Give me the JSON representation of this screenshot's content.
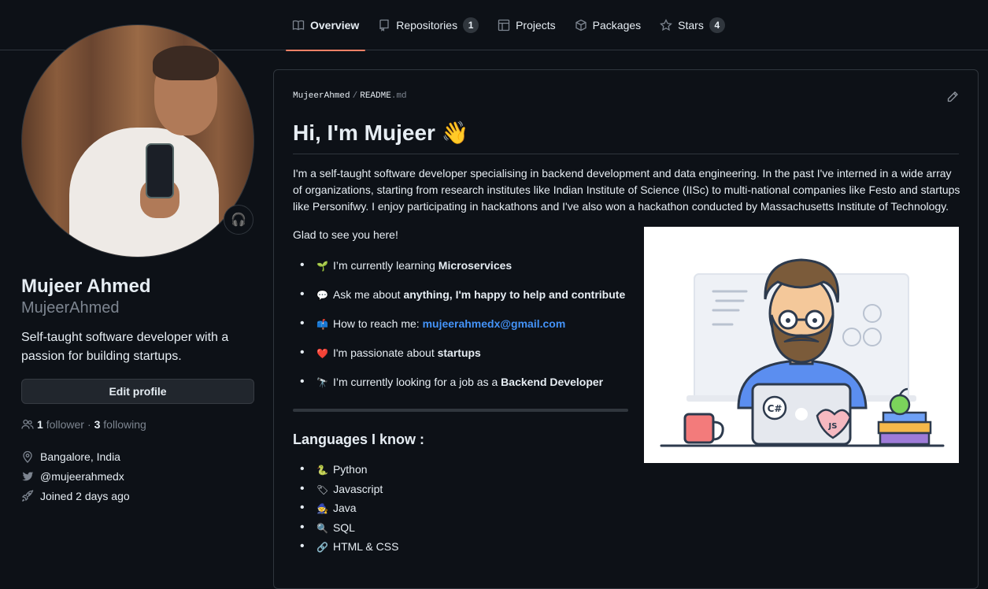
{
  "tabs": [
    {
      "label": "Overview",
      "icon": "book-icon"
    },
    {
      "label": "Repositories",
      "icon": "repo-icon",
      "count": "1"
    },
    {
      "label": "Projects",
      "icon": "table-icon"
    },
    {
      "label": "Packages",
      "icon": "package-icon"
    },
    {
      "label": "Stars",
      "icon": "star-icon",
      "count": "4"
    }
  ],
  "profile": {
    "status_emoji": "🎧",
    "name": "Mujeer Ahmed",
    "login": "MujeerAhmed",
    "bio": "Self-taught software developer with a passion for building startups.",
    "edit_label": "Edit profile",
    "followers_count": "1",
    "followers_label": "follower",
    "following_count": "3",
    "following_label": "following",
    "separator": "·",
    "location": "Bangalore, India",
    "twitter": "@mujeerahmedx",
    "joined": "Joined 2 days ago"
  },
  "readme": {
    "owner": "MujeerAhmed",
    "file": "README",
    "ext": ".md",
    "title": "Hi, I'm Mujeer",
    "title_emoji": "👋",
    "intro": "I'm a self-taught software developer specialising in backend development and data engineering. In the past I've interned in a wide array of organizations, starting from research institutes like Indian Institute of Science (IISc) to multi-national companies like Festo and startups like Personifwy. I enjoy participating in hackathons and I've also won a hackathon conducted by Massachusetts Institute of Technology.",
    "glad": "Glad to see you here!",
    "bullets": [
      {
        "emoji": "🌱",
        "text": "I’m currently learning ",
        "bold": "Microservices"
      },
      {
        "emoji": "💬",
        "text": "Ask me about ",
        "bold": "anything, I'm happy to help and contribute"
      },
      {
        "emoji": "📫",
        "text": "How to reach me: ",
        "link": "mujeerahmedx@gmail.com"
      },
      {
        "emoji": "❤️",
        "text": "I'm passionate about ",
        "bold": "startups"
      },
      {
        "emoji": "🔭",
        "text": "I’m currently looking for a job as a ",
        "bold": "Backend Developer"
      }
    ],
    "languages_title": "Languages I know :",
    "languages": [
      {
        "emoji": "🐍",
        "label": "Python"
      },
      {
        "emoji": "🏷",
        "label": "Javascript"
      },
      {
        "emoji": "🧙",
        "label": "Java"
      },
      {
        "emoji": "🔍",
        "label": "SQL"
      },
      {
        "emoji": "🔗",
        "label": "HTML & CSS"
      }
    ],
    "illustration_labels": {
      "csharp": "C#",
      "js": "JS"
    }
  }
}
